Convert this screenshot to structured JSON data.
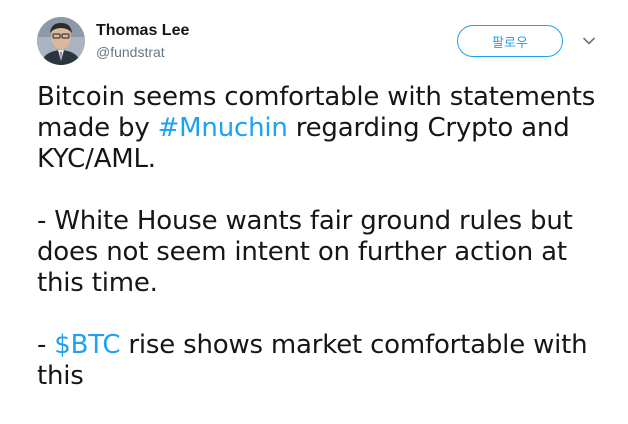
{
  "user": {
    "name": "Thomas Lee",
    "handle": "@fundstrat",
    "avatar_icon": "user-avatar-photo"
  },
  "actions": {
    "follow_label": "팔로우",
    "more_icon": "chevron-down-icon"
  },
  "tweet": {
    "p1_before": "Bitcoin seems comfortable with statements made by ",
    "p1_hashtag": "#Mnuchin",
    "p1_after": " regarding Crypto and KYC/AML.",
    "p2": "- White House wants fair ground rules but does not seem intent on further action at this time.",
    "p3_prefix": "- ",
    "p3_cashtag": "$BTC",
    "p3_after": " rise shows market comfortable with this"
  },
  "colors": {
    "accent": "#1da1f2",
    "text": "#14171a",
    "muted": "#657786"
  }
}
